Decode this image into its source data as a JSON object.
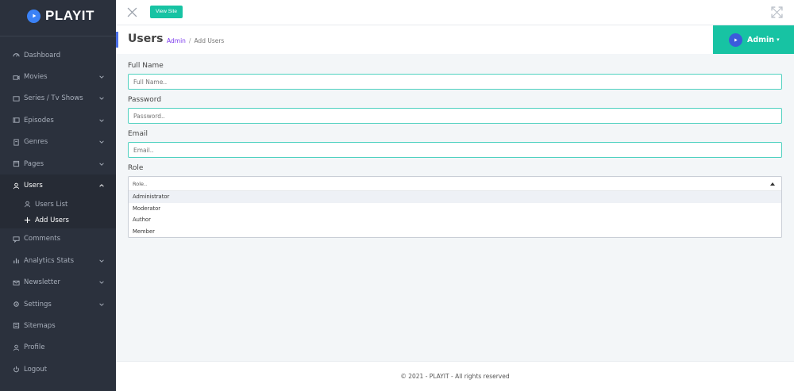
{
  "brand": {
    "name": "PLAYIT",
    "accent": "#3b82f6"
  },
  "colors": {
    "sidebar_bg": "#2b313d",
    "teal": "#17c3a3",
    "link": "#7c3aed"
  },
  "header": {
    "view_site_label": "View Site"
  },
  "title": {
    "page": "Users",
    "breadcrumb_link": "Admin",
    "breadcrumb_sep": "/",
    "breadcrumb_current": "Add Users"
  },
  "admin": {
    "label": "Admin",
    "caret": "▾"
  },
  "sidebar": {
    "items": [
      {
        "label": "Dashboard",
        "icon": "dashboard-icon"
      },
      {
        "label": "Movies",
        "icon": "video-icon"
      },
      {
        "label": "Series / Tv Shows",
        "icon": "tv-icon"
      },
      {
        "label": "Episodes",
        "icon": "episode-icon"
      },
      {
        "label": "Genres",
        "icon": "genre-icon"
      },
      {
        "label": "Pages",
        "icon": "page-icon"
      },
      {
        "label": "Users",
        "icon": "user-icon"
      },
      {
        "label": "Users List",
        "icon": "user-icon"
      },
      {
        "label": "Add Users",
        "icon": "plus-icon"
      },
      {
        "label": "Comments",
        "icon": "comment-icon"
      },
      {
        "label": "Analytics Stats",
        "icon": "chart-icon"
      },
      {
        "label": "Newsletter",
        "icon": "mail-icon"
      },
      {
        "label": "Settings",
        "icon": "gear-icon"
      },
      {
        "label": "Sitemaps",
        "icon": "sitemap-icon"
      },
      {
        "label": "Profile",
        "icon": "user-icon"
      },
      {
        "label": "Logout",
        "icon": "power-icon"
      }
    ]
  },
  "form": {
    "full_name": {
      "label": "Full Name",
      "placeholder": "Full Name.."
    },
    "password": {
      "label": "Password",
      "placeholder": "Password.."
    },
    "email": {
      "label": "Email",
      "placeholder": "Email.."
    },
    "role": {
      "label": "Role",
      "placeholder": "Role..",
      "options": [
        "Administrator",
        "Moderator",
        "Author",
        "Member"
      ]
    }
  },
  "footer": {
    "text": "© 2021 - PLAYIT - All rights reserved"
  }
}
